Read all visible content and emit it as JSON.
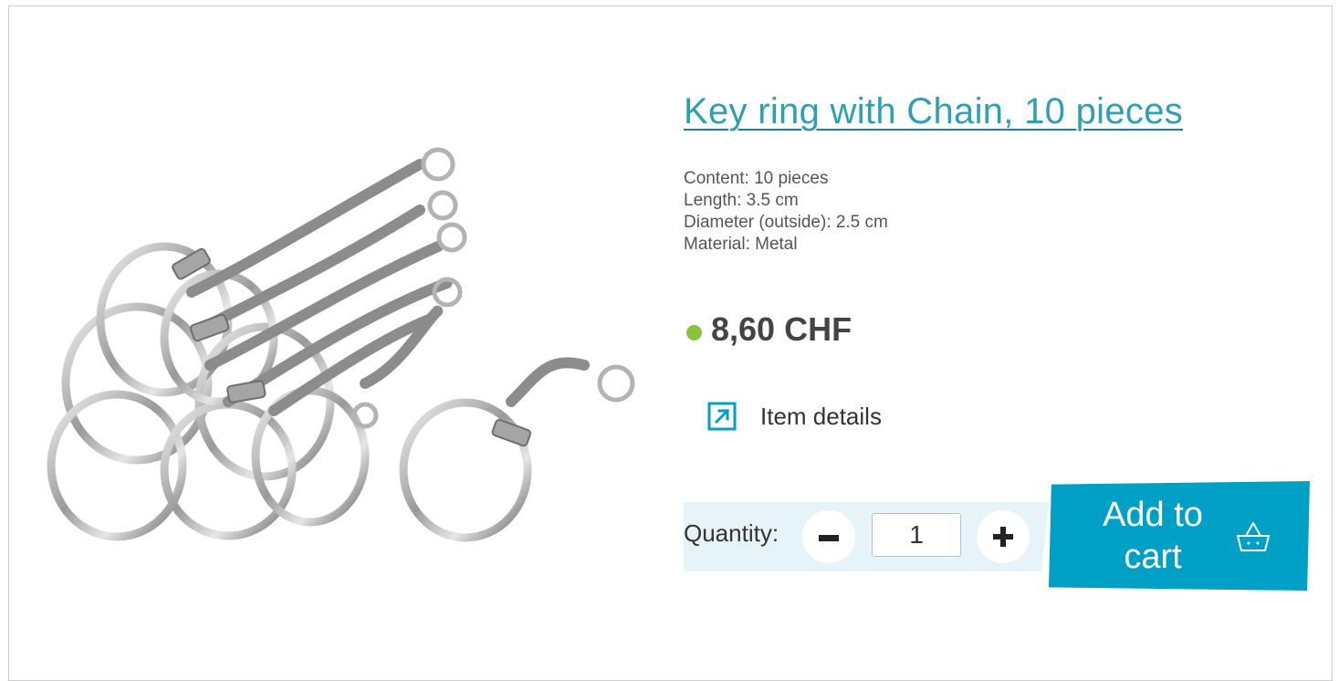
{
  "product": {
    "title": "Key ring with Chain, 10 pieces",
    "image_icon": "key-ring-chain-photo",
    "specs": [
      "Content: 10 pieces",
      "Length: 3.5 cm",
      "Diameter (outside): 2.5 cm",
      "Material: Metal"
    ],
    "price": "8,60 CHF",
    "stock_color": "#87c441"
  },
  "details_link": {
    "label": "Item details",
    "icon": "external-link-icon"
  },
  "quantity": {
    "label": "Quantity:",
    "value": "1",
    "minus_icon": "minus-icon",
    "plus_icon": "plus-icon"
  },
  "cart": {
    "label_line1": "Add to",
    "label_line2": "cart",
    "icon": "basket-icon"
  },
  "colors": {
    "title": "#2fa0b3",
    "accent": "#00a0c6",
    "quantity_band": "#e6f4f9"
  }
}
